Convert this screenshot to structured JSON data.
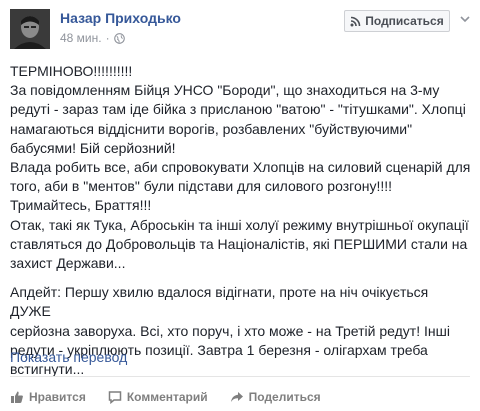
{
  "header": {
    "author": "Назар Приходько",
    "time": "48 мин.",
    "separator": "·",
    "subscribe_label": "Подписаться"
  },
  "post": {
    "paragraph1": "ТЕРМІНОВО!!!!!!!!!!\nЗа повідомленням Бійця УНСО \"Бороди\", що знаходиться на 3-му\nредуті - зараз там іде бійка з присланою \"ватою\" - \"тітушками\". Хлопці\nнамагаються віддіснити ворогів, розбавлених \"буйствуючими\"\nбабусями! Бій серйозний!\nВлада робить все, аби спровокувати Хлопців на силовий сценарій для\nтого, аби в \"ментов\" були підстави для силового розгону!!!!\nТримайтесь, Браття!!!\nОтак, такі як Тука, Аброськін та інші холуї режиму внутрішньої окупації\nставляться до Добровольців та Націоналістів, які ПЕРШИМИ стали на\nзахист Держави...",
    "paragraph2": "Апдейт: Першу хвилю вдалося відігнати, проте на ніч очікується ДУЖЕ\nсерйозна заворуха. Всі, хто поруч, і хто може - на Третій редут! Інші\nредути - укріплюють позиції. Завтра 1 березня - олігархам треба\nвстигнути..."
  },
  "translate_label": "Показать перевод",
  "actions": {
    "like": "Нравится",
    "comment": "Комментарий",
    "share": "Поделиться"
  },
  "colors": {
    "link": "#365899",
    "text": "#1d2129",
    "meta": "#90949c"
  }
}
